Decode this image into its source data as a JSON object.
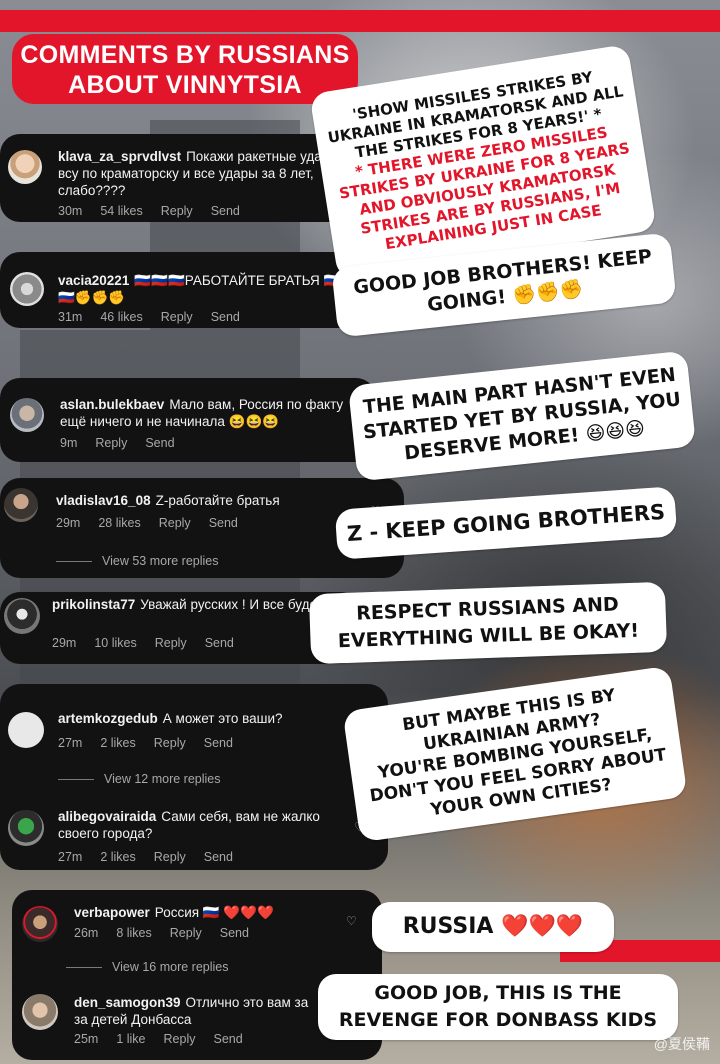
{
  "title": {
    "line1": "COMMENTS BY RUSSIANS",
    "line2": "ABOUT VINNYTSIA"
  },
  "colors": {
    "accent": "#e3152a",
    "card": "#121212",
    "bubble": "#ffffff"
  },
  "comments": [
    {
      "user": "klava_za_sprvdlvst",
      "text": "Покажи ракетные удары всу по краматорску и все удары за 8 лет, слабо????",
      "time": "30m",
      "likes": "54 likes",
      "reply": "Reply",
      "send": "Send"
    },
    {
      "user": "vacia20221",
      "text": "🇷🇺🇷🇺🇷🇺РАБОТАЙТЕ БРАТЬЯ 🇷🇺🇷🇺🇷🇺✊✊✊",
      "time": "31m",
      "likes": "46 likes",
      "reply": "Reply",
      "send": "Send"
    },
    {
      "user": "aslan.bulekbaev",
      "text": "Мало вам, Россия по факту ещё ничего и не начинала 😆😆😆",
      "time": "9m",
      "reply": "Reply",
      "send": "Send"
    },
    {
      "user": "vladislav16_08",
      "text": "Z-работайте братья",
      "time": "29m",
      "likes": "28 likes",
      "reply": "Reply",
      "send": "Send",
      "more": "View 53 more replies"
    },
    {
      "user": "prikolinsta77",
      "text": "Уважай русских ! И все будет ок",
      "time": "29m",
      "likes": "10 likes",
      "reply": "Reply",
      "send": "Send"
    },
    {
      "user": "artemkozgedub",
      "text": "А может это ваши?",
      "time": "27m",
      "likes": "2 likes",
      "reply": "Reply",
      "send": "Send",
      "more": "View 12 more replies"
    },
    {
      "user": "alibegovairaida",
      "text": "Сами себя, вам не жалко своего города?",
      "time": "27m",
      "likes": "2 likes",
      "reply": "Reply",
      "send": "Send"
    },
    {
      "user": "verbapower",
      "text": "Россия 🇷🇺 ❤️❤️❤️",
      "time": "26m",
      "likes": "8 likes",
      "reply": "Reply",
      "send": "Send",
      "more": "View 16 more replies"
    },
    {
      "user": "den_samogon39",
      "text": "Отлично это вам за за детей Донбасса",
      "time": "25m",
      "likes": "1 like",
      "reply": "Reply",
      "send": "Send"
    }
  ],
  "bubbles": {
    "b1": {
      "black": [
        "'SHOW MISSILES STRIKES BY",
        "UKRAINE IN KRAMATORSK AND ALL",
        "THE STRIKES FOR 8 YEARS!' *"
      ],
      "red": [
        "* THERE WERE ZERO MISSILES",
        "STRIKES BY UKRAINE FOR 8 YEARS",
        "AND OBVIOUSLY KRAMATORSK",
        "STRIKES ARE BY RUSSIANS, I'M",
        "EXPLAINING JUST IN CASE"
      ]
    },
    "b2": [
      "GOOD JOB BROTHERS! KEEP",
      "GOING! ✊✊✊"
    ],
    "b3": [
      "THE MAIN PART HASN'T EVEN",
      "STARTED YET BY RUSSIA, YOU",
      "DESERVE MORE! 😆😆😆"
    ],
    "b4": [
      "Z - KEEP GOING BROTHERS"
    ],
    "b5": [
      "RESPECT RUSSIANS AND",
      "EVERYTHING WILL BE OKAY!"
    ],
    "b6": [
      "BUT MAYBE THIS IS BY",
      "UKRAINIAN ARMY?",
      "YOU'RE BOMBING YOURSELF,",
      "DON'T YOU FEEL SORRY ABOUT",
      "YOUR OWN CITIES?"
    ],
    "b7": [
      "RUSSIA ❤️❤️❤️"
    ],
    "b8": [
      "GOOD JOB, THIS IS THE",
      "REVENGE FOR DONBASS KIDS"
    ]
  },
  "watermark": "@夏侯鞴"
}
